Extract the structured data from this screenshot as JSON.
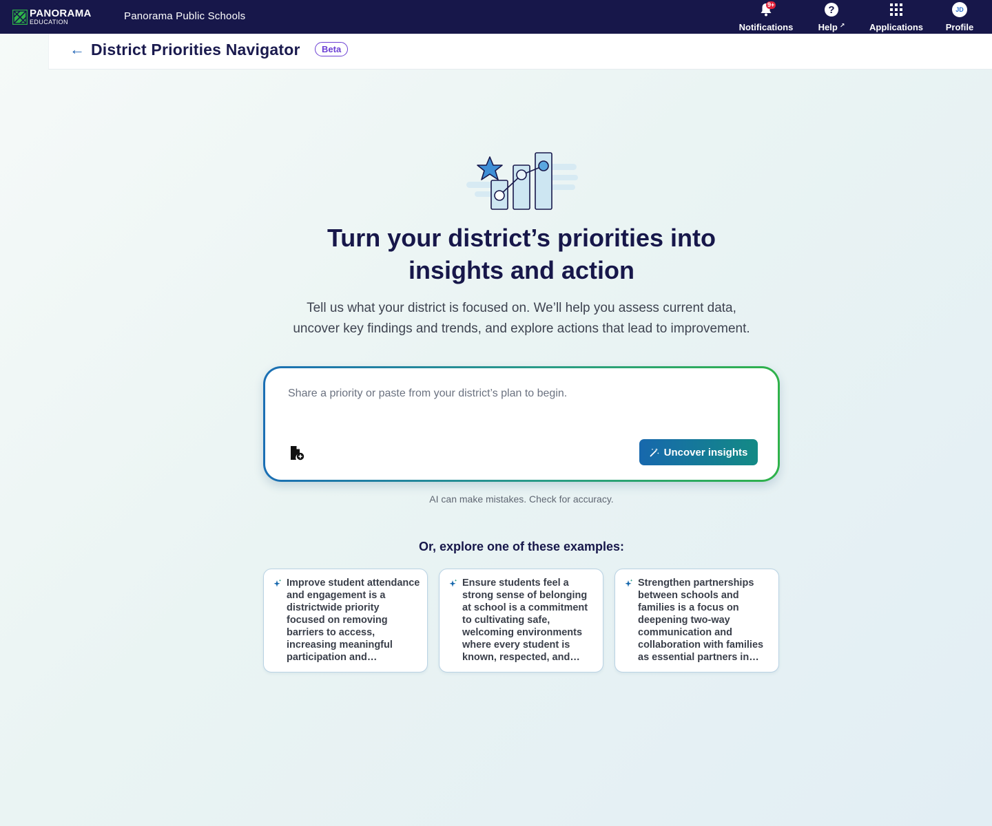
{
  "topnav": {
    "logo_main": "PANORAMA",
    "logo_sub": "EDUCATION",
    "org_name": "Panorama Public Schools",
    "notifications": {
      "label": "Notifications",
      "badge": "9+"
    },
    "help": {
      "label": "Help",
      "icon": "?",
      "ext": "↗"
    },
    "applications": {
      "label": "Applications"
    },
    "profile": {
      "label": "Profile",
      "initials": "JD"
    }
  },
  "subheader": {
    "back_icon": "←",
    "title": "District Priorities Navigator",
    "badge": "Beta"
  },
  "hero": {
    "headline_line1": "Turn your district’s priorities into",
    "headline_line2": "insights and action",
    "subtext_line1": "Tell us what your district is focused on. We’ll help you assess current data,",
    "subtext_line2": "uncover key findings and trends, and explore actions that lead to improvement."
  },
  "prompt": {
    "placeholder": "Share a priority or paste from your district’s plan to begin.",
    "value": "",
    "submit_label": "Uncover insights"
  },
  "disclaimer": "AI can make mistakes. Check for accuracy.",
  "examples": {
    "title": "Or, explore one of these examples:",
    "items": [
      {
        "text": "Improve student attendance and engagement is a districtwide priority focused on removing barriers to access, increasing meaningful participation and engagement for every student."
      },
      {
        "text": "Ensure students feel a strong sense of belonging at school is a commitment to cultivating safe, welcoming environments where every student is known, respected, and supported by caring adults."
      },
      {
        "text": "Strengthen partnerships between schools and families is a focus on deepening two-way communication and collaboration with families as essential partners in student success."
      }
    ]
  },
  "colors": {
    "nav_bg": "#17174a",
    "primary_text": "#17174a",
    "accent_blue": "#1768ad",
    "accent_green": "#2fb24a",
    "beta_purple": "#6b3fd4",
    "badge_red": "#e0223b"
  },
  "icons": [
    "bell-icon",
    "help-icon",
    "apps-grid-icon",
    "avatar",
    "back-arrow-icon",
    "attach-file-icon",
    "magic-wand-icon",
    "sparkle-icon",
    "chart-illustration"
  ]
}
